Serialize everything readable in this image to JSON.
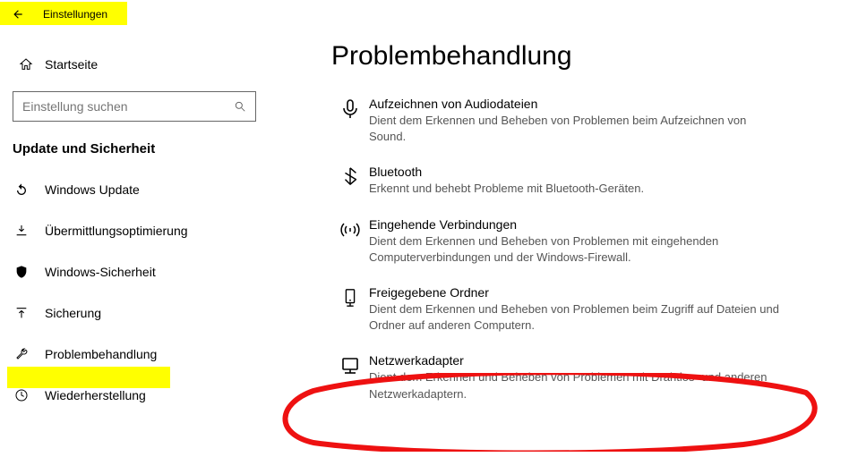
{
  "titlebar": {
    "title": "Einstellungen"
  },
  "sidebar": {
    "home_label": "Startseite",
    "search_placeholder": "Einstellung suchen",
    "section_heading": "Update und Sicherheit",
    "items": [
      {
        "label": "Windows Update"
      },
      {
        "label": "Übermittlungsoptimierung"
      },
      {
        "label": "Windows-Sicherheit"
      },
      {
        "label": "Sicherung"
      },
      {
        "label": "Problembehandlung"
      },
      {
        "label": "Wiederherstellung"
      }
    ]
  },
  "page": {
    "title": "Problembehandlung",
    "items": [
      {
        "title": "Aufzeichnen von Audiodateien",
        "desc": "Dient dem Erkennen und Beheben von Problemen beim Aufzeichnen von Sound."
      },
      {
        "title": "Bluetooth",
        "desc": "Erkennt und behebt Probleme mit Bluetooth-Geräten."
      },
      {
        "title": "Eingehende Verbindungen",
        "desc": "Dient dem Erkennen und Beheben von Problemen mit eingehenden Computerverbindungen und der Windows-Firewall."
      },
      {
        "title": "Freigegebene Ordner",
        "desc": "Dient dem Erkennen und Beheben von Problemen beim Zugriff auf Dateien und Ordner auf anderen Computern."
      },
      {
        "title": "Netzwerkadapter",
        "desc": "Dient dem Erkennen und Beheben von Problemen mit Drahtlos- und anderen Netzwerkadaptern."
      }
    ]
  },
  "annotations": {
    "highlight_titlebar": true,
    "highlight_nav_index": 4,
    "circle_item_index": 4
  }
}
